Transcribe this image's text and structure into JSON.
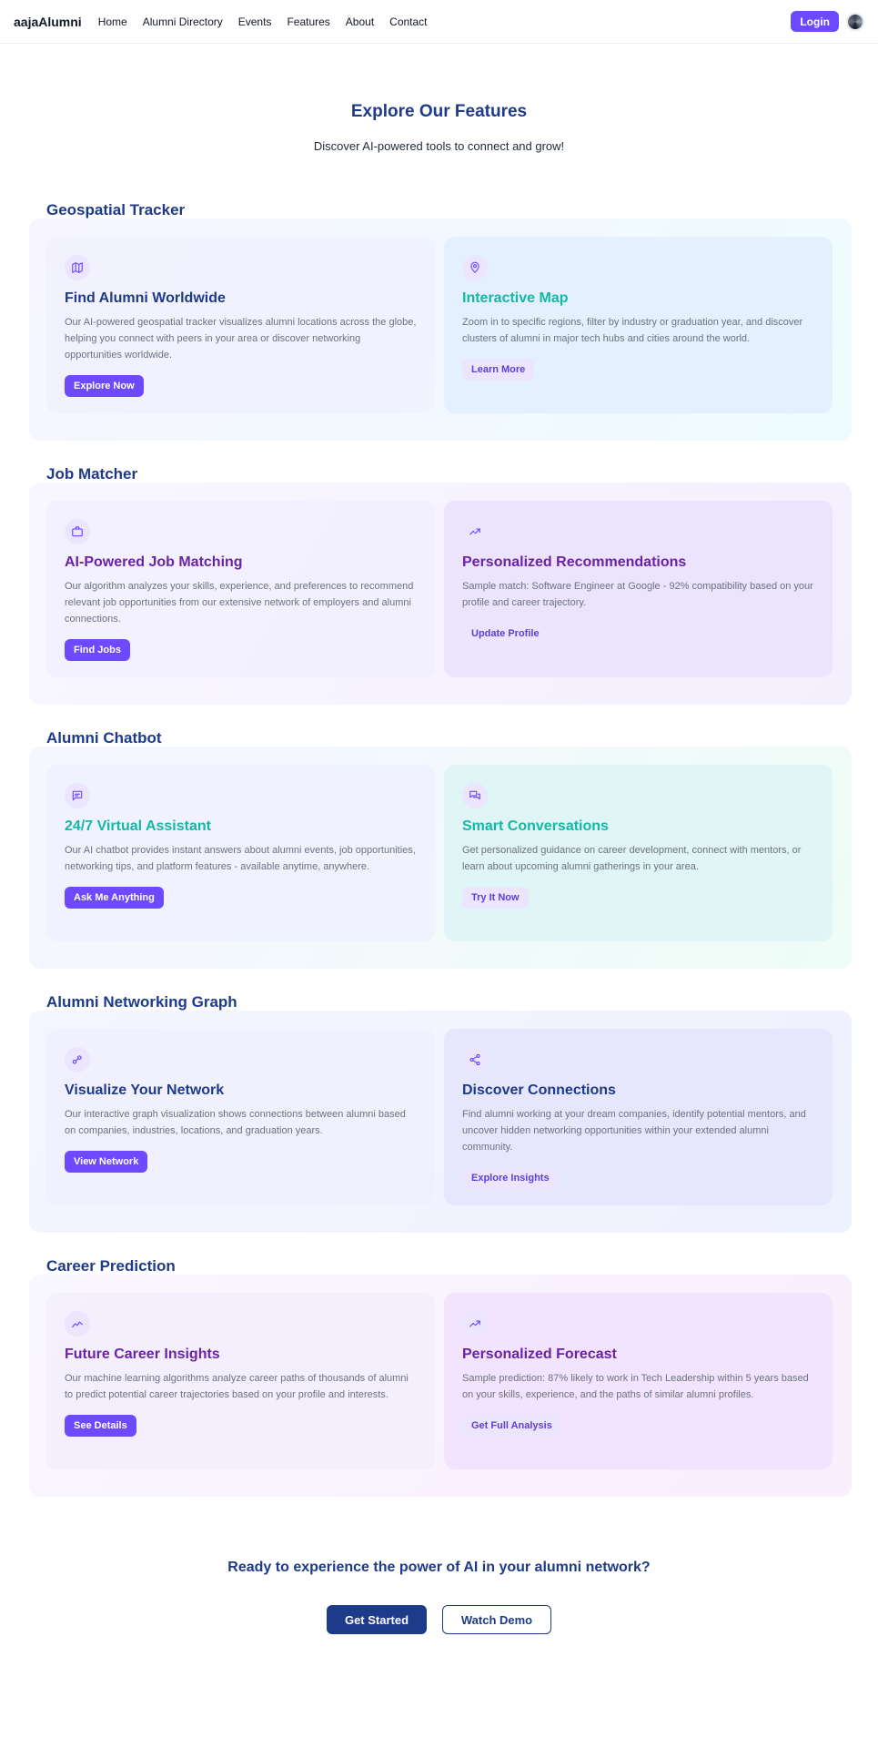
{
  "nav": {
    "brand": "aajaAlumni",
    "links": [
      "Home",
      "Alumni Directory",
      "Events",
      "Features",
      "About",
      "Contact"
    ],
    "login_label": "Login"
  },
  "hero": {
    "title": "Explore Our Features",
    "subtitle": "Discover AI-powered tools to connect and grow!"
  },
  "sections": [
    {
      "title": "Geospatial Tracker",
      "left": {
        "icon": "map-icon",
        "title": "Find Alumni Worldwide",
        "description": "Our AI-powered geospatial tracker visualizes alumni locations across the globe, helping you connect with peers in your area or discover networking opportunities worldwide.",
        "button": "Explore Now"
      },
      "right": {
        "icon": "map-pin-icon",
        "title": "Interactive Map",
        "description": "Zoom in to specific regions, filter by industry or graduation year, and discover clusters of alumni in major tech hubs and cities around the world.",
        "button": "Learn More"
      }
    },
    {
      "title": "Job Matcher",
      "left": {
        "icon": "briefcase-icon",
        "title": "AI-Powered Job Matching",
        "description": "Our algorithm analyzes your skills, experience, and preferences to recommend relevant job opportunities from our extensive network of employers and alumni connections.",
        "button": "Find Jobs"
      },
      "right": {
        "icon": "trending-up-icon",
        "title": "Personalized Recommendations",
        "description": "Sample match: Software Engineer at Google - 92% compatibility based on your profile and career trajectory.",
        "button": "Update Profile"
      }
    },
    {
      "title": "Alumni Chatbot",
      "left": {
        "icon": "chat-text-icon",
        "title": "24/7 Virtual Assistant",
        "description": "Our AI chatbot provides instant answers about alumni events, job opportunities, networking tips, and platform features - available anytime, anywhere.",
        "button": "Ask Me Anything"
      },
      "right": {
        "icon": "chat-bubbles-icon",
        "title": "Smart Conversations",
        "description": "Get personalized guidance on career development, connect with mentors, or learn about upcoming alumni gatherings in your area.",
        "button": "Try It Now"
      }
    },
    {
      "title": "Alumni Networking Graph",
      "left": {
        "icon": "network-icon",
        "title": "Visualize Your Network",
        "description": "Our interactive graph visualization shows connections between alumni based on companies, industries, locations, and graduation years.",
        "button": "View Network"
      },
      "right": {
        "icon": "share-icon",
        "title": "Discover Connections",
        "description": "Find alumni working at your dream companies, identify potential mentors, and uncover hidden networking opportunities within your extended alumni community.",
        "button": "Explore Insights"
      }
    },
    {
      "title": "Career Prediction",
      "left": {
        "icon": "line-chart-icon",
        "title": "Future Career Insights",
        "description": "Our machine learning algorithms analyze career paths of thousands of alumni to predict potential career trajectories based on your profile and interests.",
        "button": "See Details"
      },
      "right": {
        "icon": "trending-up-icon",
        "title": "Personalized Forecast",
        "description": "Sample prediction: 87% likely to work in Tech Leadership within 5 years based on your skills, experience, and the paths of similar alumni profiles.",
        "button": "Get Full Analysis"
      }
    }
  ],
  "cta": {
    "title": "Ready to experience the power of AI in your alumni network?",
    "primary": "Get Started",
    "secondary": "Watch Demo"
  },
  "colors": {
    "accent": "#6d4aff",
    "navy": "#1e3a8a",
    "teal": "#14b8a6",
    "purple": "#6b21a8"
  }
}
